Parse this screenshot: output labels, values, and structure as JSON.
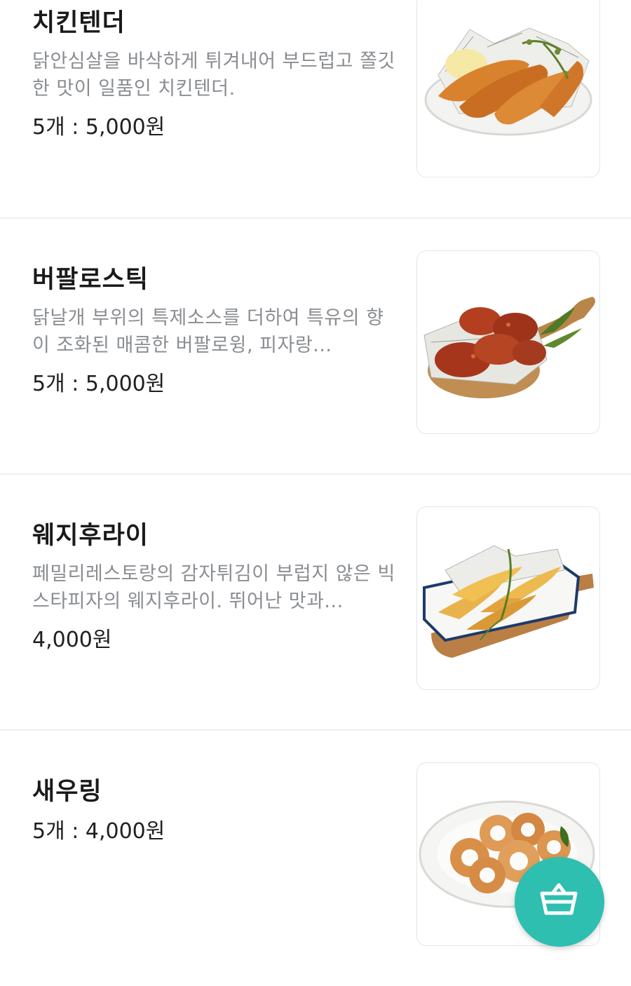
{
  "menu": {
    "items": [
      {
        "name": "치킨텐더",
        "description": "닭안심살을 바삭하게 튀겨내어 부드럽고 쫄깃한 맛이 일품인 치킨텐더.",
        "price": "5개 : 5,000원",
        "image": "chicken-tender-photo"
      },
      {
        "name": "버팔로스틱",
        "description": "닭날개 부위의 특제소스를 더하여 특유의 향이 조화된 매콤한 버팔로윙, 피자랑...",
        "price": "5개 : 5,000원",
        "image": "buffalo-stick-photo"
      },
      {
        "name": "웨지후라이",
        "description": "페밀리레스토랑의 감자튀김이 부럽지 않은 빅스타피자의 웨지후라이. 뛰어난 맛과...",
        "price": "4,000원",
        "image": "wedge-fries-photo"
      },
      {
        "name": "새우링",
        "price": "5개 : 4,000원",
        "image": "shrimp-ring-photo"
      }
    ]
  },
  "cart_button": {
    "icon": "shopping-basket-icon",
    "color": "#2ebfb0"
  }
}
